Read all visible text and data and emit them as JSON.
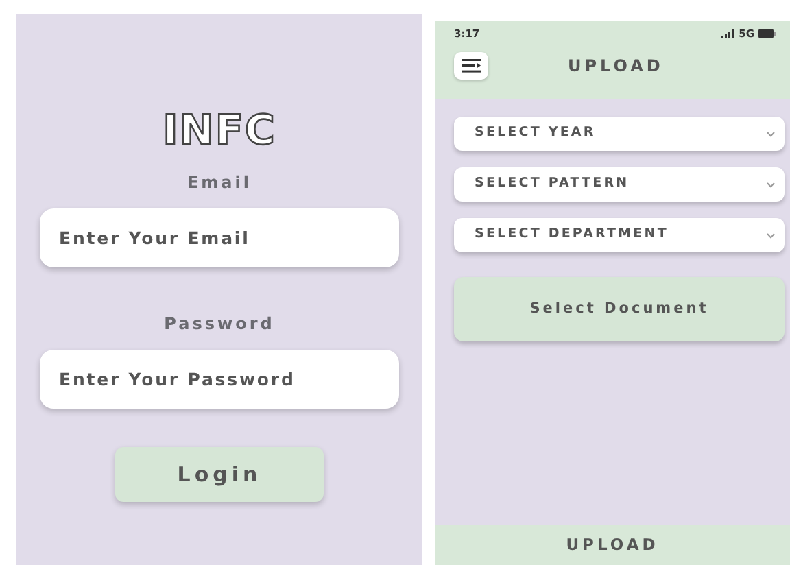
{
  "login": {
    "logo": "INFC",
    "fields": [
      {
        "label": "Email",
        "placeholder": "Enter Your Email"
      },
      {
        "label": "Password",
        "placeholder": "Enter Your Password"
      }
    ],
    "button": "Login"
  },
  "upload": {
    "status_bar": {
      "time": "3:17",
      "network": "5G"
    },
    "title": "UPLOAD",
    "dropdowns": [
      "SELECT YEAR",
      "SELECT PATTERN",
      "SELECT DEPARTMENT"
    ],
    "document_button": "Select Document",
    "footer_button": "UPLOAD"
  }
}
